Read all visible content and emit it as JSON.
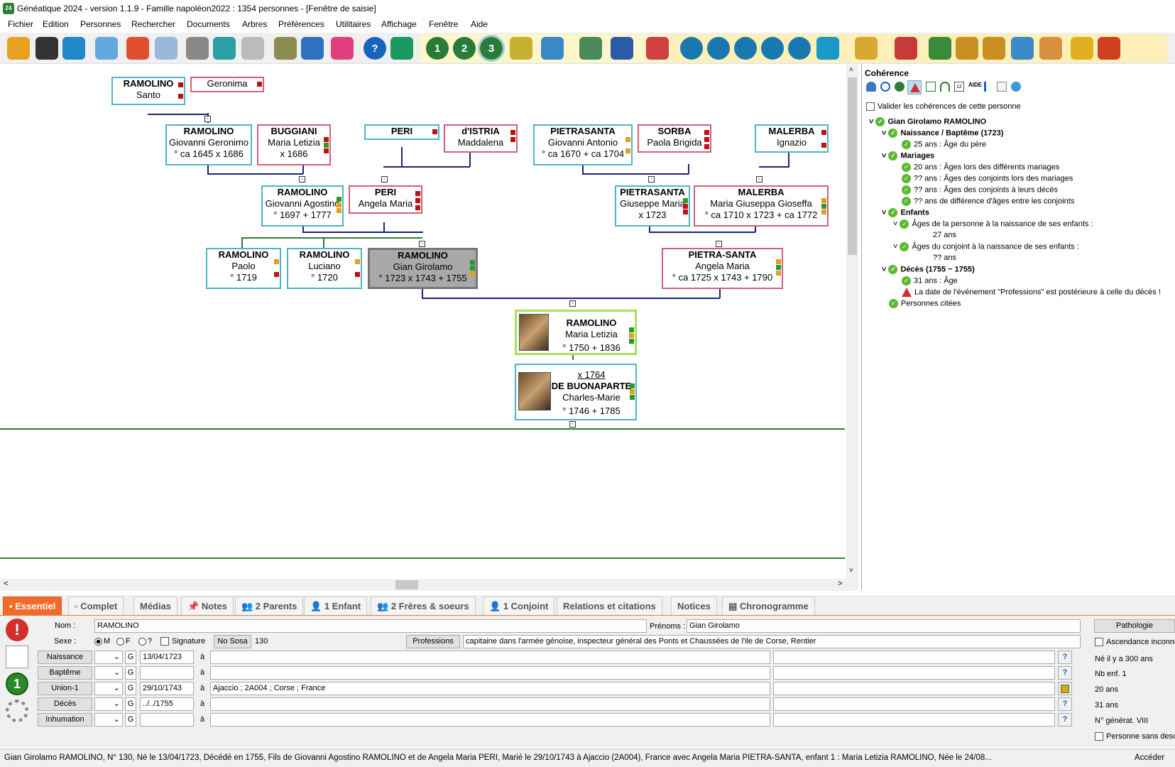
{
  "window": {
    "title": "Généatique 2024 - version 1.1.9 - Famille napoléon2022 : 1354 personnes - [Fenêtre de saisie]"
  },
  "menu": [
    "Fichier",
    "Edition",
    "Personnes",
    "Rechercher",
    "Documents",
    "Arbres",
    "Préférences",
    "Utilitaires",
    "Affichage",
    "Fenêtre",
    "Aide"
  ],
  "toolbar": {
    "gen1": "1",
    "gen2": "2",
    "gen3": "3"
  },
  "tree": {
    "santo": {
      "name": "RAMOLINO",
      "first": "Santo"
    },
    "geronima": {
      "first": "Geronima"
    },
    "giovanni_g": {
      "name": "RAMOLINO",
      "first": "Giovanni Geronimo",
      "dates": "° ca 1645   x 1686"
    },
    "buggiani": {
      "name": "BUGGIANI",
      "first": "Maria Letizia",
      "dates": "x 1686"
    },
    "peri_top": {
      "name": "PERI"
    },
    "distria": {
      "name": "d'ISTRIA",
      "first": "Maddalena"
    },
    "pietrasanta_ga": {
      "name": "PIETRASANTA",
      "first": "Giovanni Antonio",
      "dates": "° ca 1670   + ca 1704"
    },
    "sorba": {
      "name": "SORBA",
      "first": "Paola Brigida"
    },
    "malerba_i": {
      "name": "MALERBA",
      "first": "Ignazio"
    },
    "giovanni_a": {
      "name": "RAMOLINO",
      "first": "Giovanni Agostino",
      "dates": "° 1697   + 1777"
    },
    "peri_am": {
      "name": "PERI",
      "first": "Angela Maria"
    },
    "pietrasanta_gm": {
      "name": "PIETRASANTA",
      "first": "Giuseppe Maria",
      "dates": "x 1723"
    },
    "malerba_mg": {
      "name": "MALERBA",
      "first": "Maria Giuseppa Gioseffa",
      "dates": "° ca 1710   x 1723   + ca 1772"
    },
    "paolo": {
      "name": "RAMOLINO",
      "first": "Paolo",
      "dates": "° 1719"
    },
    "luciano": {
      "name": "RAMOLINO",
      "first": "Luciano",
      "dates": "° 1720"
    },
    "gian": {
      "name": "RAMOLINO",
      "first": "Gian Girolamo",
      "dates": "° 1723   x 1743   + 1755"
    },
    "angela": {
      "name": "PIETRA-SANTA",
      "first": "Angela Maria",
      "dates": "° ca 1725   x 1743   + 1790"
    },
    "letizia": {
      "name": "RAMOLINO",
      "first": "Maria Letizia",
      "dates": "° 1750   + 1836"
    },
    "charles": {
      "marriage": "x 1764",
      "name": "DE BUONAPARTE",
      "first": "Charles-Marie",
      "dates": "° 1746   + 1785"
    }
  },
  "coherence": {
    "title": "Cohérence",
    "validate": "Valider les cohérences de cette personne",
    "items": [
      "Gian Girolamo RAMOLINO",
      "Naissance / Baptême (1723)",
      "25 ans : Âge du père",
      "Mariages",
      "20  ans : Âges lors des différents mariages",
      "??  ans : Âges des conjoints lors des mariages",
      "??  ans : Âges des conjoints à leurs décès",
      "??  ans de différence d'âges entre les conjoints",
      "Enfants",
      "Âges de la personne à la naissance de ses enfants :",
      "27  ans",
      "Âges du conjoint à la naissance de ses enfants :",
      "??  ans",
      "Décès (1755 ~ 1755)",
      "31 ans : Âge",
      "La date de l'événement \"Professions\" est postérieure à celle du décès !",
      "Personnes citées"
    ]
  },
  "tabs": [
    "Essentiel",
    "Complet",
    "Médias",
    "Notes",
    "2 Parents",
    "1 Enfant",
    "2 Frères & soeurs",
    "1 Conjoint",
    "Relations et citations",
    "Notices",
    "Chronogramme"
  ],
  "form": {
    "nom_label": "Nom :",
    "nom": "RAMOLINO",
    "prenoms_label": "Prénoms :",
    "prenoms": "Gian Girolamo",
    "sexe_label": "Sexe :",
    "m": "M",
    "f": "F",
    "q": "?",
    "signature": "Signature",
    "sosa_btn": "No Sosa",
    "sosa": "130",
    "prof_btn": "Professions",
    "prof": "capitaine dans l'armée génoise, inspecteur général des Ponts et Chaussées de l'ile de Corse, Rentier",
    "events": [
      {
        "label": "Naissance",
        "g": "G",
        "date": "13/04/1723",
        "a": "à",
        "place": ""
      },
      {
        "label": "Baptême",
        "g": "G",
        "date": "",
        "a": "à",
        "place": ""
      },
      {
        "label": "Union-1",
        "g": "G",
        "date": "29/10/1743",
        "a": "à",
        "place": "Ajaccio ; 2A004 ; Corse ; France"
      },
      {
        "label": "Décès",
        "g": "G",
        "date": "../../1755",
        "a": "à",
        "place": ""
      },
      {
        "label": "Inhumation",
        "g": "G",
        "date": "",
        "a": "à",
        "place": ""
      }
    ],
    "pathologie": "Pathologie",
    "ascendance": "Ascendance inconnue",
    "info": [
      "Né il y a 300 ans",
      "Nb enf. 1",
      "20 ans",
      "31 ans",
      "N° générat. VIII"
    ],
    "sans_des": "Personne sans descendance"
  },
  "status": {
    "text": "Gian Girolamo RAMOLINO, N° 130, Né le 13/04/1723, Décédé en 1755, Fils de Giovanni Agostino RAMOLINO et de Angela Maria PERI, Marié le 29/10/1743 à Ajaccio (2A004), France avec Angela Maria PIETRA-SANTA, enfant 1 : Maria Letizia RAMOLINO, Née le 24/08...",
    "right": "Accéder"
  }
}
